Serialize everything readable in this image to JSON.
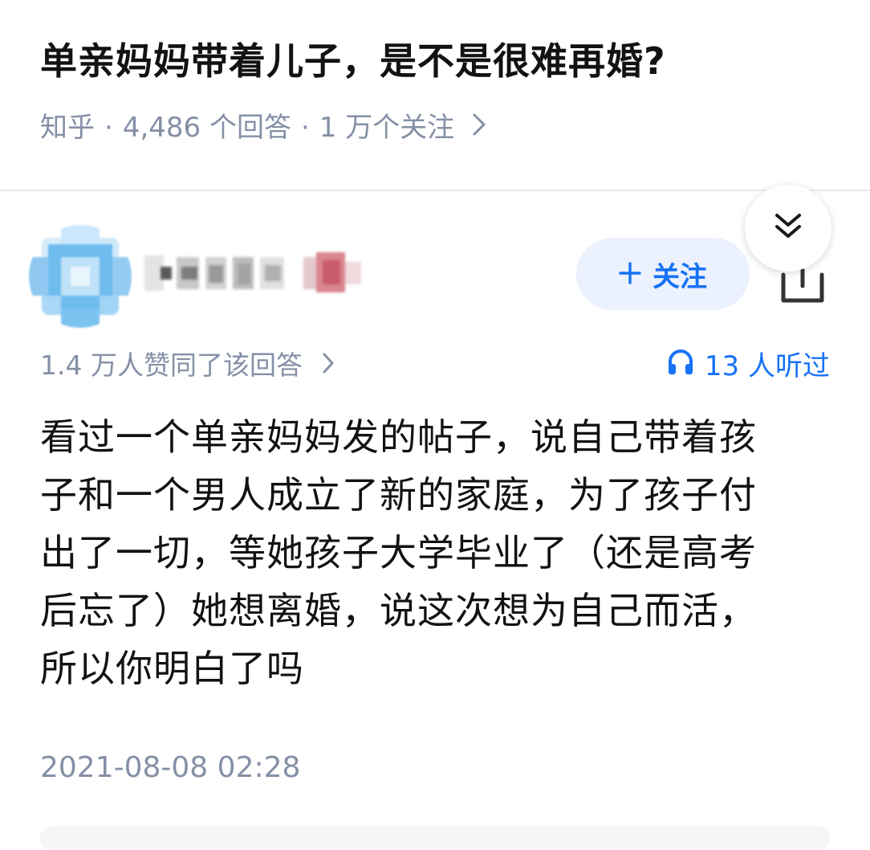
{
  "question": {
    "title": "单亲妈妈带着儿子，是不是很难再婚?",
    "source": "知乎",
    "answer_count": "4,486 个回答",
    "follower_count": "1 万个关注"
  },
  "author": {
    "follow_label": "关注"
  },
  "answer": {
    "votes_text": "1.4 万人赞同了该回答",
    "listen_text": "13 人听过",
    "lines": [
      "看过一个单亲妈妈发的帖子，说自己带着孩",
      "子和一个男人成立了新的家庭，为了孩子付",
      "出了一切，等她孩子大学毕业了（还是高考",
      "后忘了）她想离婚，说这次想为自己而活，",
      "所以你明白了吗"
    ],
    "timestamp": "2021-08-08 02:28"
  },
  "colors": {
    "accent": "#1772f6",
    "follow_bg": "#ebf1fd",
    "meta_gray": "#8590a6",
    "text": "#121212"
  },
  "icons": {
    "meta_chevron": "chevron-right-icon",
    "collapse": "double-chevron-down-icon",
    "share": "share-icon",
    "listen": "headphones-icon",
    "follow_plus": "plus-icon"
  }
}
